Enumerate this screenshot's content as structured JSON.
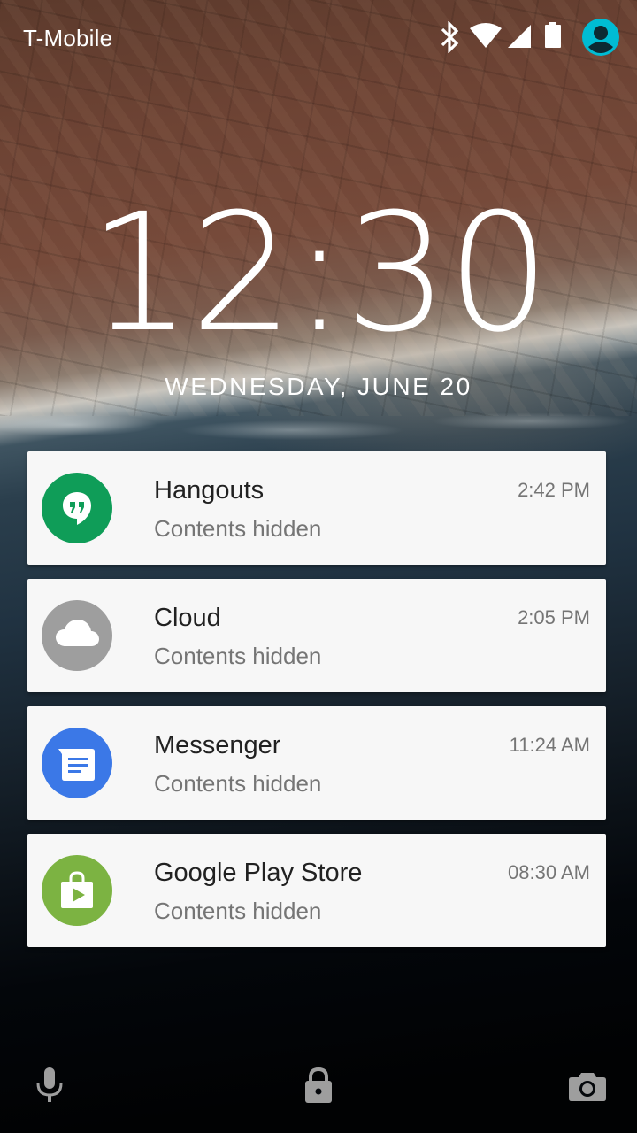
{
  "status_bar": {
    "carrier": "T-Mobile",
    "icons": [
      "bluetooth-icon",
      "wifi-icon",
      "cell-signal-icon",
      "battery-icon",
      "user-avatar-icon"
    ]
  },
  "lockscreen": {
    "time": "12:30",
    "date": "WEDNESDAY, JUNE 20"
  },
  "notifications": [
    {
      "app": "Hangouts",
      "text": "Contents hidden",
      "time": "2:42 PM",
      "icon": "hangouts-icon",
      "color": "#0f9d58"
    },
    {
      "app": "Cloud",
      "text": "Contents hidden",
      "time": "2:05 PM",
      "icon": "cloud-icon",
      "color": "#9e9e9e"
    },
    {
      "app": "Messenger",
      "text": "Contents hidden",
      "time": "11:24 AM",
      "icon": "messenger-icon",
      "color": "#3b78e7"
    },
    {
      "app": "Google Play Store",
      "text": "Contents hidden",
      "time": "08:30 AM",
      "icon": "play-store-icon",
      "color": "#7cb342"
    }
  ],
  "bottom_bar": {
    "icons": [
      "microphone-icon",
      "lock-icon",
      "camera-icon"
    ]
  },
  "colors": {
    "avatar_accent": "#00bcd4",
    "card_background": "#f7f7f7",
    "title_text": "#212121",
    "secondary_text": "#757575"
  }
}
